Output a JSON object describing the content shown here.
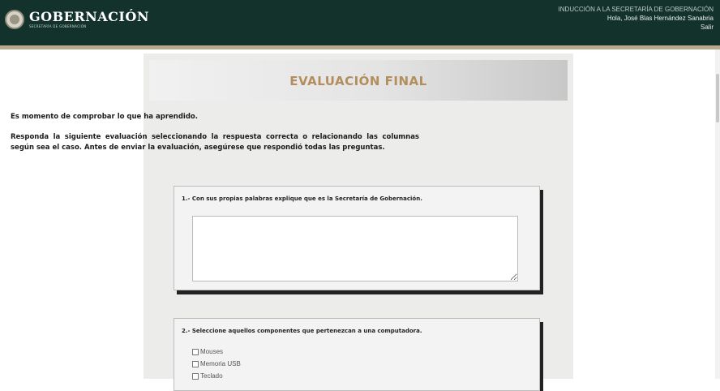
{
  "header": {
    "brand_name": "GOBERNACIÓN",
    "brand_sub": "SECRETARÍA DE GOBERNACIÓN",
    "course": "INDUCCIÓN A LA SECRETARÍA DE GOBERNACIÓN",
    "greeting": "Hola, José Blas Hernández Sanabria",
    "logout": "Salir",
    "bg_color": "#12322b",
    "accent_color": "#b9a98c"
  },
  "page": {
    "title": "EVALUACIÓN FINAL",
    "title_color": "#b38e5d",
    "intro_1": "Es momento de comprobar lo que ha aprendido.",
    "intro_2": "Responda la siguiente evaluación seleccionando la respuesta correcta o relacionando las columnas según sea el caso. Antes de enviar la evaluación, asegúrese que respondió todas las preguntas."
  },
  "questions": [
    {
      "text": "1.- Con sus propias palabras explique que es la Secretaría de Gobernación.",
      "answer_value": ""
    },
    {
      "text": "2.- Seleccione aquellos componentes que pertenezcan a una computadora.",
      "options": [
        "Mouses",
        "Memoria USB",
        "Teclado"
      ]
    }
  ],
  "icons": {
    "logo": "mexico-seal-icon"
  }
}
